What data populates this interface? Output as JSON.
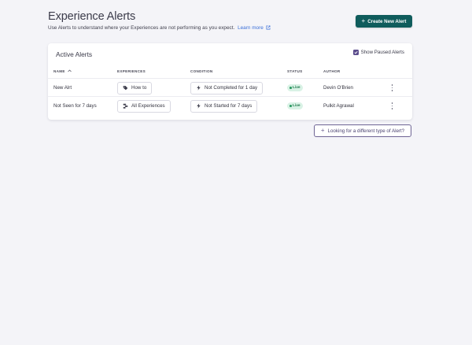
{
  "header": {
    "title": "Experience Alerts",
    "subtitle": "Use Alerts to understand where your Experiences are not performing as you expect.",
    "learn_more": "Learn more",
    "create_button": "Create New Alert"
  },
  "card": {
    "title": "Active Alerts",
    "show_paused_label": "Show Paused Alerts",
    "show_paused_checked": true
  },
  "table": {
    "columns": [
      "NAME",
      "EXPERIENCES",
      "CONDITION",
      "STATUS",
      "AUTHOR"
    ],
    "rows": [
      {
        "name": "New Alrt",
        "experience": "How to",
        "experience_icon": "tag-icon",
        "condition": "Not Completed for 1 day",
        "condition_icon": "lightning-icon",
        "status": "Live",
        "author": "Devin O'Brien"
      },
      {
        "name": "Not Seen for 7 days",
        "experience": "All Experiences",
        "experience_icon": "flows-icon",
        "condition": "Not Started for 7 days",
        "condition_icon": "lightning-icon",
        "status": "Live",
        "author": "Pulkit Agrawal"
      }
    ]
  },
  "footer": {
    "looking_button": "Looking for a different type of Alert?"
  },
  "colors": {
    "primary": "#0f5c5c",
    "accent_purple": "#5b4c8c",
    "live_bg": "#d9f2e5",
    "live_text": "#1f7a4d",
    "link": "#3a6fd8"
  }
}
